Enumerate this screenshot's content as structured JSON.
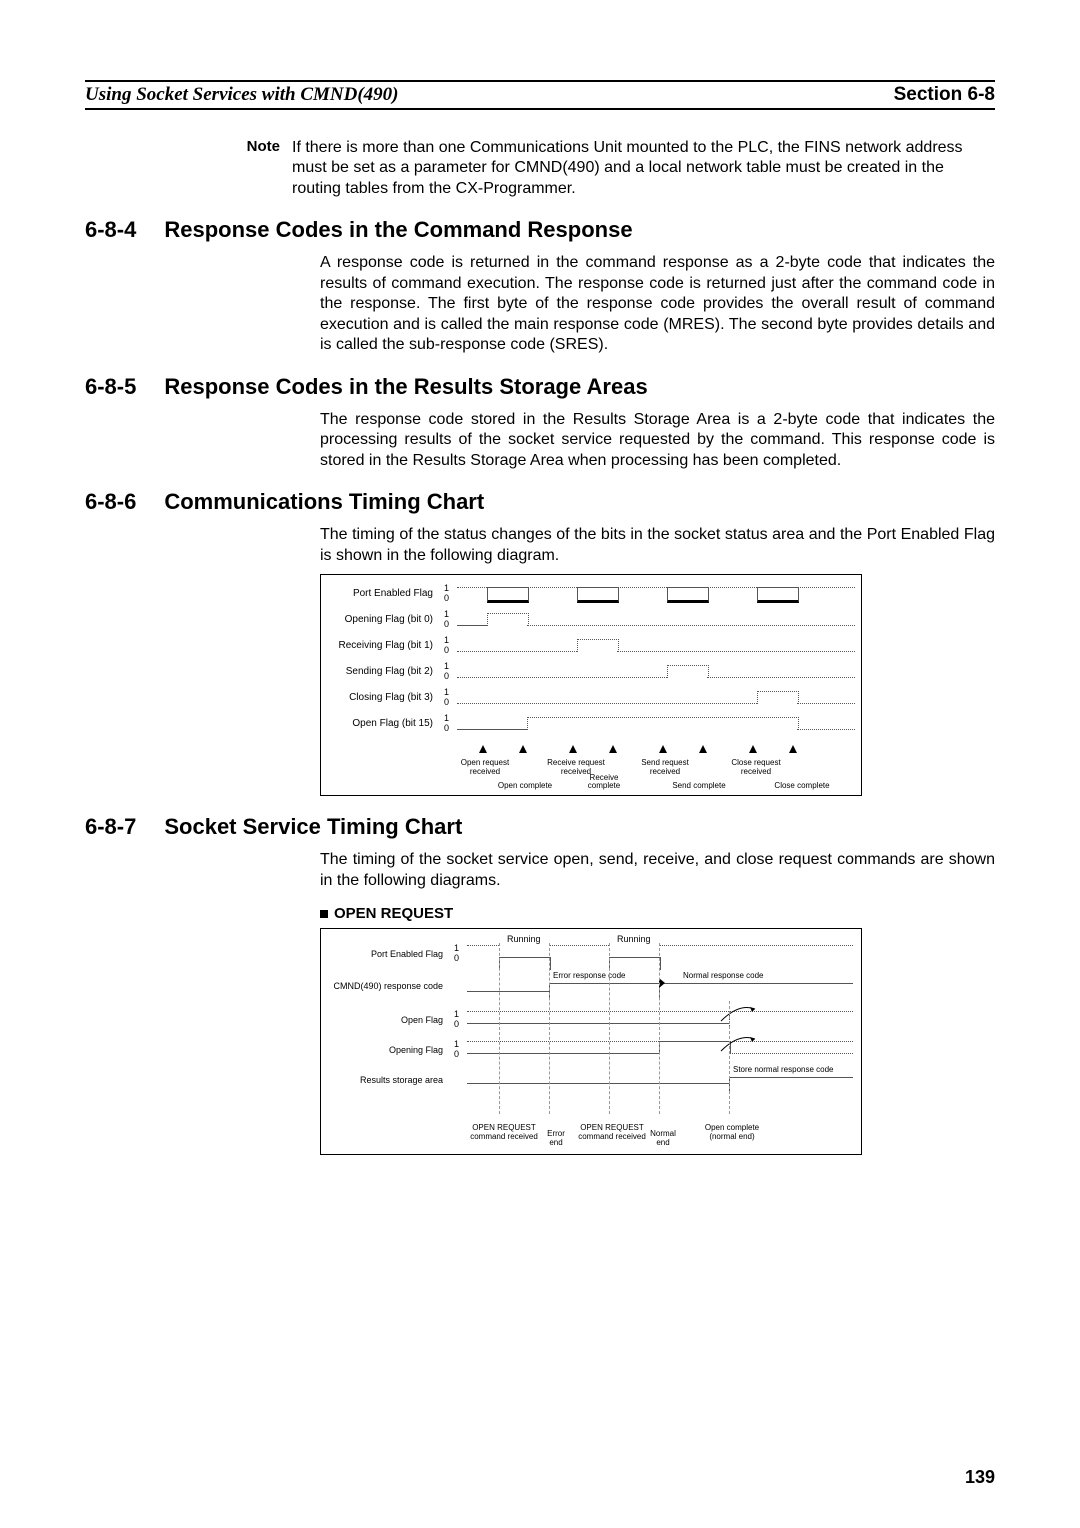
{
  "header": {
    "left": "Using Socket Services with CMND(490)",
    "right": "Section 6-8"
  },
  "note": {
    "label": "Note",
    "body": "If there is more than one Communications Unit mounted to the PLC, the FINS network address must be set as a parameter for CMND(490) and a local network table must be created in the routing tables from the CX-Programmer."
  },
  "s684": {
    "num": "6-8-4",
    "title": "Response Codes in the Command Response",
    "body": "A response code is returned in the command response as a 2-byte code that indicates the results of command execution. The response code is returned just after the command code in the response. The first byte of the response code provides the overall result of command execution and is called the main response code (MRES). The second byte provides details and is called the sub-response code (SRES)."
  },
  "s685": {
    "num": "6-8-5",
    "title": "Response Codes in the Results Storage Areas",
    "body": "The response code stored in the Results Storage Area is a 2-byte code that indicates the processing results of the socket service requested by the command. This response code is stored in the Results Storage Area when processing has been completed."
  },
  "s686": {
    "num": "6-8-6",
    "title": "Communications Timing Chart",
    "body": "The timing of the status changes of the bits in the socket status area and the Port Enabled Flag is shown in the following diagram."
  },
  "s687": {
    "num": "6-8-7",
    "title": "Socket Service Timing Chart",
    "body": "The timing of the socket service open, send, receive, and close request commands are shown in the following diagrams.",
    "sub": "OPEN REQUEST"
  },
  "chart1": {
    "row_labels": [
      "Port Enabled Flag",
      "Opening Flag (bit 0)",
      "Receiving Flag (bit 1)",
      "Sending Flag (bit 2)",
      "Closing Flag (bit 3)",
      "Open Flag (bit 15)"
    ],
    "axis_hi": "1",
    "axis_lo": "0",
    "upper_events": [
      "Open request received",
      "Receive request received",
      "Send request received",
      "Close request received"
    ],
    "lower_events": [
      "Open complete",
      "Receive complete",
      "Send complete",
      "Close complete"
    ]
  },
  "chart2": {
    "row_labels": [
      "Port Enabled Flag",
      "CMND(490) response code",
      "Open Flag",
      "Opening Flag",
      "Results storage area"
    ],
    "axis_hi": "1",
    "axis_lo": "0",
    "running": "Running",
    "resp_err": "Error response code",
    "resp_norm": "Normal response code",
    "store_norm": "Store normal response code",
    "bot1": "OPEN REQUEST command received",
    "bot2": "Error end",
    "bot3": "OPEN REQUEST command received",
    "bot4": "Normal end",
    "bot5": "Open complete (normal end)"
  },
  "page_number": "139",
  "chart_data": [
    {
      "type": "timing",
      "title": "Communications Timing Chart — socket status bits vs events",
      "signals": [
        {
          "name": "Port Enabled Flag",
          "levels": [
            1,
            0,
            1,
            0,
            1,
            0,
            1,
            0,
            1
          ],
          "edges_at": [
            "open_req",
            "open_cmp",
            "recv_req",
            "recv_cmp",
            "send_req",
            "send_cmp",
            "close_req",
            "close_cmp"
          ]
        },
        {
          "name": "Opening Flag (bit 0)",
          "levels": [
            0,
            1,
            0
          ],
          "edges_at": [
            "open_req",
            "open_cmp"
          ]
        },
        {
          "name": "Receiving Flag (bit 1)",
          "levels": [
            0,
            1,
            0
          ],
          "edges_at": [
            "recv_req",
            "recv_cmp"
          ]
        },
        {
          "name": "Sending Flag (bit 2)",
          "levels": [
            0,
            1,
            0
          ],
          "edges_at": [
            "send_req",
            "send_cmp"
          ]
        },
        {
          "name": "Closing Flag (bit 3)",
          "levels": [
            0,
            1,
            0
          ],
          "edges_at": [
            "close_req",
            "close_cmp"
          ]
        },
        {
          "name": "Open Flag (bit 15)",
          "levels": [
            0,
            1,
            0
          ],
          "edges_at": [
            "open_cmp",
            "close_cmp"
          ]
        }
      ],
      "events": [
        "open_req",
        "open_cmp",
        "recv_req",
        "recv_cmp",
        "send_req",
        "send_cmp",
        "close_req",
        "close_cmp"
      ]
    },
    {
      "type": "timing",
      "title": "OPEN REQUEST — socket service timing",
      "signals": [
        {
          "name": "Port Enabled Flag",
          "seq": [
            "1",
            "Running(0)",
            "1",
            "Running(0)",
            "1"
          ]
        },
        {
          "name": "CMND(490) response code",
          "seq": [
            "—",
            "Error response code",
            "—",
            "Normal response code"
          ]
        },
        {
          "name": "Open Flag",
          "seq": [
            "0",
            "0",
            "1 (after normal end)"
          ]
        },
        {
          "name": "Opening Flag",
          "seq": [
            "0",
            "0",
            "1 during open",
            "0"
          ]
        },
        {
          "name": "Results storage area",
          "seq": [
            "—",
            "—",
            "Store normal response code"
          ]
        }
      ],
      "events": [
        "OPEN REQUEST command received",
        "Error end",
        "OPEN REQUEST command received",
        "Normal end",
        "Open complete (normal end)"
      ]
    }
  ]
}
